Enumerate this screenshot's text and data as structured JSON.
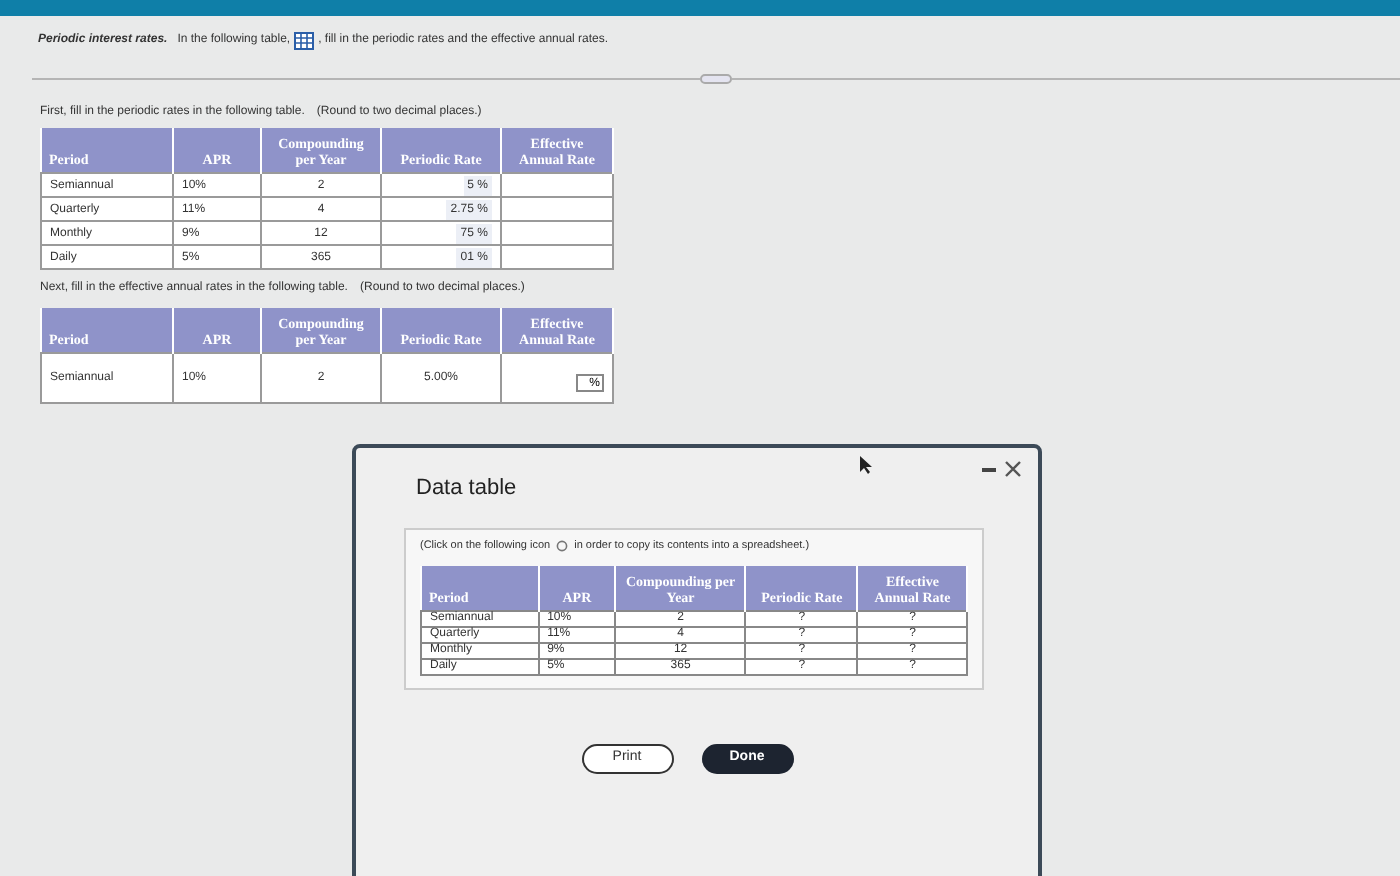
{
  "header": {
    "title": "Periodic interest rates.",
    "before_icon": "In the following table,",
    "after_icon": ", fill in the periodic rates and the effective annual rates."
  },
  "part1": {
    "instruction": "First, fill in the periodic rates in the following table.",
    "note": "(Round to two decimal places.)",
    "columns": [
      "Period",
      "APR",
      "Compounding per Year",
      "Periodic Rate",
      "Effective Annual Rate"
    ],
    "rows": [
      {
        "period": "Semiannual",
        "apr": "10%",
        "compounding": "2",
        "periodic_rate": {
          "value": "5",
          "unit": "%"
        }
      },
      {
        "period": "Quarterly",
        "apr": "11%",
        "compounding": "4",
        "periodic_rate": {
          "value": "2.75",
          "unit": "%"
        }
      },
      {
        "period": "Monthly",
        "apr": "9%",
        "compounding": "12",
        "periodic_rate": {
          "value": "75",
          "unit": "%"
        }
      },
      {
        "period": "Daily",
        "apr": "5%",
        "compounding": "365",
        "periodic_rate": {
          "value": "01",
          "unit": "%"
        }
      }
    ]
  },
  "part2": {
    "instruction": "Next, fill in the effective annual rates in the following table.",
    "note": "(Round to two decimal places.)",
    "columns": [
      "Period",
      "APR",
      "Compounding per Year",
      "Periodic Rate",
      "Effective Annual Rate"
    ],
    "rows": [
      {
        "period": "Semiannual",
        "apr": "10%",
        "compounding": "2",
        "periodic_rate": "5.00%",
        "effective_unit": "%"
      }
    ]
  },
  "dialog": {
    "title": "Data table",
    "note_before": "(Click on the following icon",
    "note_after": "in order to copy its contents into a spreadsheet.)",
    "columns": [
      "Period",
      "APR",
      "Compounding per Year",
      "Periodic Rate",
      "Effective Annual Rate"
    ],
    "rows": [
      [
        "Semiannual",
        "10%",
        "2",
        "?",
        "?"
      ],
      [
        "Quarterly",
        "11%",
        "4",
        "?",
        "?"
      ],
      [
        "Monthly",
        "9%",
        "12",
        "?",
        "?"
      ],
      [
        "Daily",
        "5%",
        "365",
        "?",
        "?"
      ]
    ],
    "buttons": [
      {
        "label": "Print",
        "kind": "outline"
      },
      {
        "label": "Done",
        "kind": "primary"
      }
    ]
  }
}
